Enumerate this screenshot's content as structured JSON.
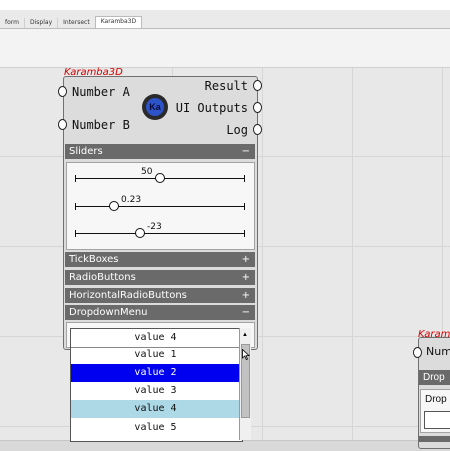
{
  "tabs": [
    "form",
    "Display",
    "Intersect",
    "Karamba3D"
  ],
  "component": {
    "label": "Karamba3D",
    "inputs": [
      "Number A",
      "Number B"
    ],
    "outputs": [
      "Result",
      "UI Outputs",
      "Log"
    ],
    "logo_text": "Ka",
    "sections": {
      "sliders": {
        "title": "Sliders",
        "toggle": "−"
      },
      "tickboxes": {
        "title": "TickBoxes",
        "toggle": "+"
      },
      "radiobuttons": {
        "title": "RadioButtons",
        "toggle": "+"
      },
      "horizontalradiobuttons": {
        "title": "HorizontalRadioButtons",
        "toggle": "+"
      },
      "dropdownmenu": {
        "title": "DropdownMenu",
        "toggle": "−"
      }
    },
    "sliders": [
      {
        "value": "50",
        "fraction": 0.5
      },
      {
        "value": "0.23",
        "fraction": 0.23
      },
      {
        "value": "-23",
        "fraction": 0.38
      }
    ],
    "dropdown": {
      "selected": "value 4",
      "items": [
        "value 1",
        "value 2",
        "value 3",
        "value 4",
        "value 5"
      ],
      "highlighted": "value 2",
      "hovered": "value 4"
    }
  },
  "component2": {
    "label": "Karam",
    "input": "Numb",
    "section": "Drop",
    "field_label": "Drop"
  },
  "colors": {
    "label_red": "#d40000",
    "section_gray": "#6a6a6a",
    "highlight_blue": "#0000f0",
    "hover_lightblue": "#add8e6"
  }
}
